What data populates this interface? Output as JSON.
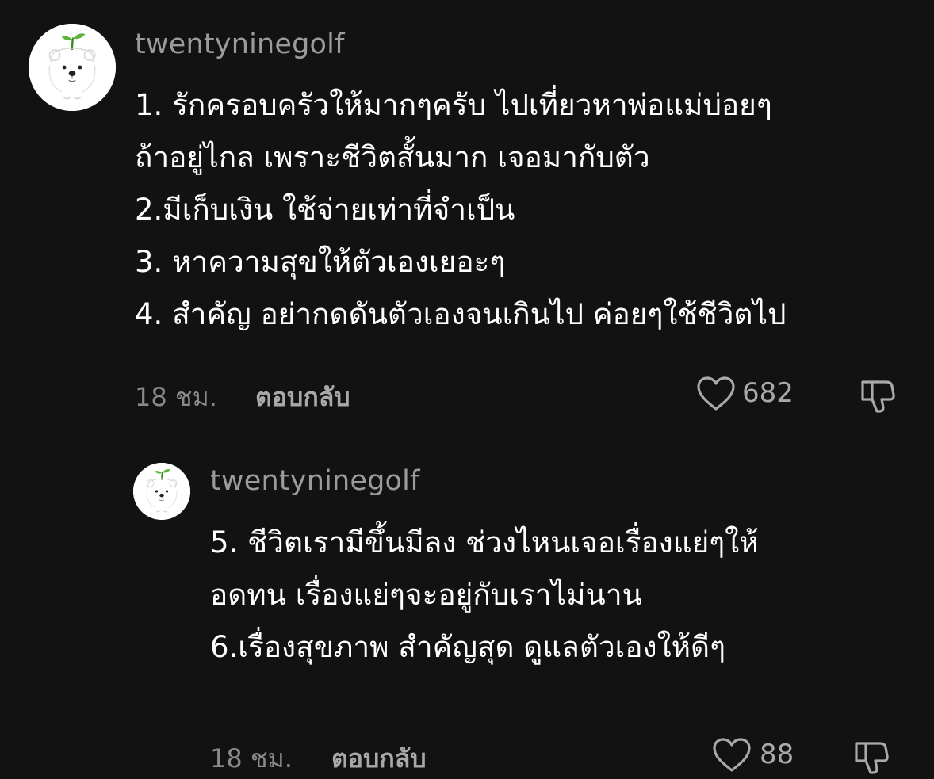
{
  "comments": [
    {
      "username": "twentyninegolf",
      "lines": [
        "1. รักครอบครัวให้มากๆครับ ไปเที่ยวหาพ่อแม่บ่อยๆ",
        "ถ้าอยู่ไกล เพราะชีวิตสั้นมาก เจอมากับตัว",
        "2.มีเก็บเงิน ใช้จ่ายเท่าที่จำเป็น",
        "3. หาความสุขให้ตัวเองเยอะๆ",
        "4. สำคัญ อย่ากดดันตัวเองจนเกินไป ค่อยๆใช้ชีวิตไป"
      ],
      "time": "18 ชม.",
      "reply_label": "ตอบกลับ",
      "likes": "682"
    },
    {
      "username": "twentyninegolf",
      "lines": [
        "5. ชีวิตเรามีขึ้นมีลง ช่วงไหนเจอเรื่องแย่ๆให้",
        "อดทน เรื่องแย่ๆจะอยู่กับเราไม่นาน",
        "6.เรื่องสุขภาพ สำคัญสุด ดูแลตัวเองให้ดีๆ"
      ],
      "time": "18 ชม.",
      "reply_label": "ตอบกลับ",
      "likes": "88"
    }
  ],
  "icons": {
    "avatar": "bear-avatar-icon",
    "like": "heart-icon",
    "dislike": "thumbs-down-icon"
  },
  "colors": {
    "background": "#121212",
    "text": "#ffffff",
    "muted": "#9b9b9b"
  }
}
